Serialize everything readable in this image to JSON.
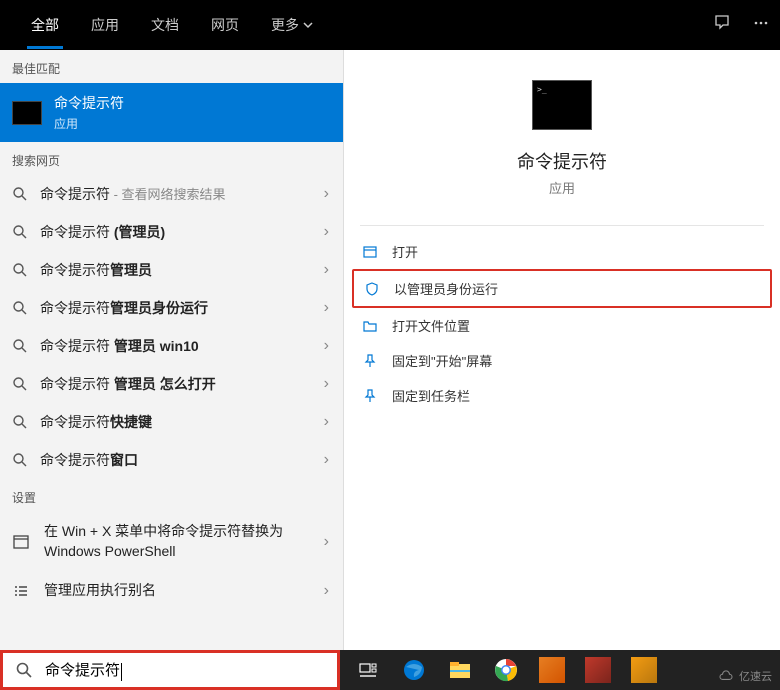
{
  "header": {
    "tabs": {
      "all": "全部",
      "apps": "应用",
      "docs": "文档",
      "web": "网页",
      "more": "更多"
    }
  },
  "sections": {
    "best_match": "最佳匹配",
    "web_search": "搜索网页",
    "settings": "设置"
  },
  "best_match": {
    "title": "命令提示符",
    "subtitle": "应用"
  },
  "web_results": [
    {
      "prefix": "命令提示符",
      "bold": "",
      "hint": " - 查看网络搜索结果"
    },
    {
      "prefix": "命令提示符 ",
      "bold": "(管理员)",
      "hint": ""
    },
    {
      "prefix": "命令提示符",
      "bold": "管理员",
      "hint": ""
    },
    {
      "prefix": "命令提示符",
      "bold": "管理员身份运行",
      "hint": ""
    },
    {
      "prefix": "命令提示符 ",
      "bold": "管理员 win10",
      "hint": ""
    },
    {
      "prefix": "命令提示符 ",
      "bold": "管理员 怎么打开",
      "hint": ""
    },
    {
      "prefix": "命令提示符",
      "bold": "快捷键",
      "hint": ""
    },
    {
      "prefix": "命令提示符",
      "bold": "窗口",
      "hint": ""
    }
  ],
  "settings_items": [
    "在 Win + X 菜单中将命令提示符替换为 Windows PowerShell",
    "管理应用执行别名"
  ],
  "preview": {
    "title": "命令提示符",
    "subtitle": "应用",
    "actions": {
      "open": "打开",
      "run_admin": "以管理员身份运行",
      "open_location": "打开文件位置",
      "pin_start": "固定到\"开始\"屏幕",
      "pin_taskbar": "固定到任务栏"
    }
  },
  "search": {
    "query": "命令提示符"
  },
  "watermark": "亿速云"
}
